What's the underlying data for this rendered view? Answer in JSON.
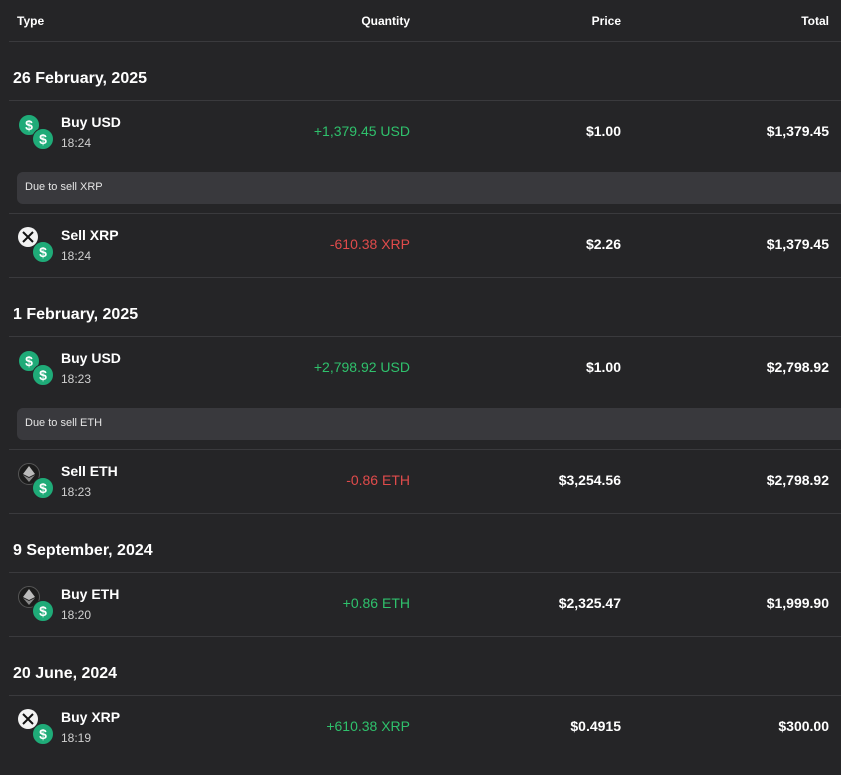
{
  "header": {
    "type": "Type",
    "quantity": "Quantity",
    "price": "Price",
    "total": "Total"
  },
  "colors": {
    "positive": "#2fc16c",
    "negative": "#e04b4b",
    "background": "#252527",
    "usd_green": "#1fab78"
  },
  "groups": [
    {
      "date": "26 February, 2025",
      "rows": [
        {
          "title": "Buy USD",
          "time": "18:24",
          "quantity": "+1,379.45 USD",
          "price": "$1.00",
          "total": "$1,379.45",
          "icon": "usd-icon"
        },
        {
          "note": "Due to sell XRP"
        },
        {
          "title": "Sell XRP",
          "time": "18:24",
          "quantity": "-610.38 XRP",
          "price": "$2.26",
          "total": "$1,379.45",
          "icon": "xrp-icon"
        }
      ]
    },
    {
      "date": "1 February, 2025",
      "rows": [
        {
          "title": "Buy USD",
          "time": "18:23",
          "quantity": "+2,798.92 USD",
          "price": "$1.00",
          "total": "$2,798.92",
          "icon": "usd-icon"
        },
        {
          "note": "Due to sell ETH"
        },
        {
          "title": "Sell ETH",
          "time": "18:23",
          "quantity": "-0.86 ETH",
          "price": "$3,254.56",
          "total": "$2,798.92",
          "icon": "eth-icon"
        }
      ]
    },
    {
      "date": "9 September, 2024",
      "rows": [
        {
          "title": "Buy ETH",
          "time": "18:20",
          "quantity": "+0.86 ETH",
          "price": "$2,325.47",
          "total": "$1,999.90",
          "icon": "eth-icon"
        }
      ]
    },
    {
      "date": "20 June, 2024",
      "rows": [
        {
          "title": "Buy XRP",
          "time": "18:19",
          "quantity": "+610.38 XRP",
          "price": "$0.4915",
          "total": "$300.00",
          "icon": "xrp-icon"
        }
      ]
    }
  ]
}
